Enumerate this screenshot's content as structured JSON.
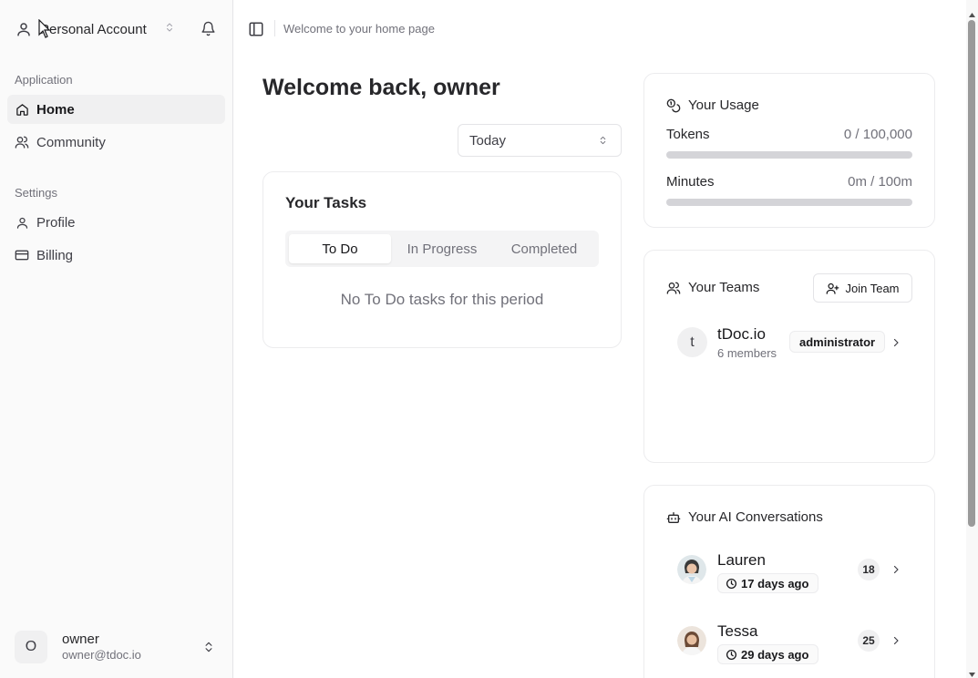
{
  "sidebar": {
    "account_name": "Personal Account",
    "sections": [
      {
        "label": "Application",
        "items": [
          {
            "label": "Home",
            "active": true
          },
          {
            "label": "Community"
          }
        ]
      },
      {
        "label": "Settings",
        "items": [
          {
            "label": "Profile"
          },
          {
            "label": "Billing"
          }
        ]
      }
    ],
    "user": {
      "initial": "O",
      "name": "owner",
      "email": "owner@tdoc.io"
    }
  },
  "topbar": {
    "breadcrumb": "Welcome to your home page"
  },
  "main": {
    "welcome": "Welcome back, owner",
    "period_select": "Today",
    "tasks": {
      "title": "Your Tasks",
      "tabs": [
        {
          "label": "To Do",
          "active": true
        },
        {
          "label": "In Progress"
        },
        {
          "label": "Completed"
        }
      ],
      "empty_text": "No To Do tasks for this period"
    }
  },
  "usage": {
    "title": "Your Usage",
    "rows": [
      {
        "label": "Tokens",
        "value": "0 / 100,000",
        "progress": 0
      },
      {
        "label": "Minutes",
        "value": "0m / 100m",
        "progress": 0
      }
    ]
  },
  "teams": {
    "title": "Your Teams",
    "join_label": "Join Team",
    "items": [
      {
        "initial": "t",
        "name": "tDoc.io",
        "members": "6 members",
        "role": "administrator"
      }
    ]
  },
  "ai": {
    "title": "Your AI Conversations",
    "items": [
      {
        "name": "Lauren",
        "time": "17 days ago",
        "count": "18"
      },
      {
        "name": "Tessa",
        "time": "29 days ago",
        "count": "25"
      }
    ]
  },
  "icons": [
    "user-icon",
    "chevrons-up-down-icon",
    "bell-icon",
    "home-icon",
    "users-icon",
    "user-icon",
    "credit-card-icon",
    "panel-left-icon",
    "coins-icon",
    "user-plus-icon",
    "chevron-right-icon",
    "bot-icon",
    "clock-icon"
  ]
}
